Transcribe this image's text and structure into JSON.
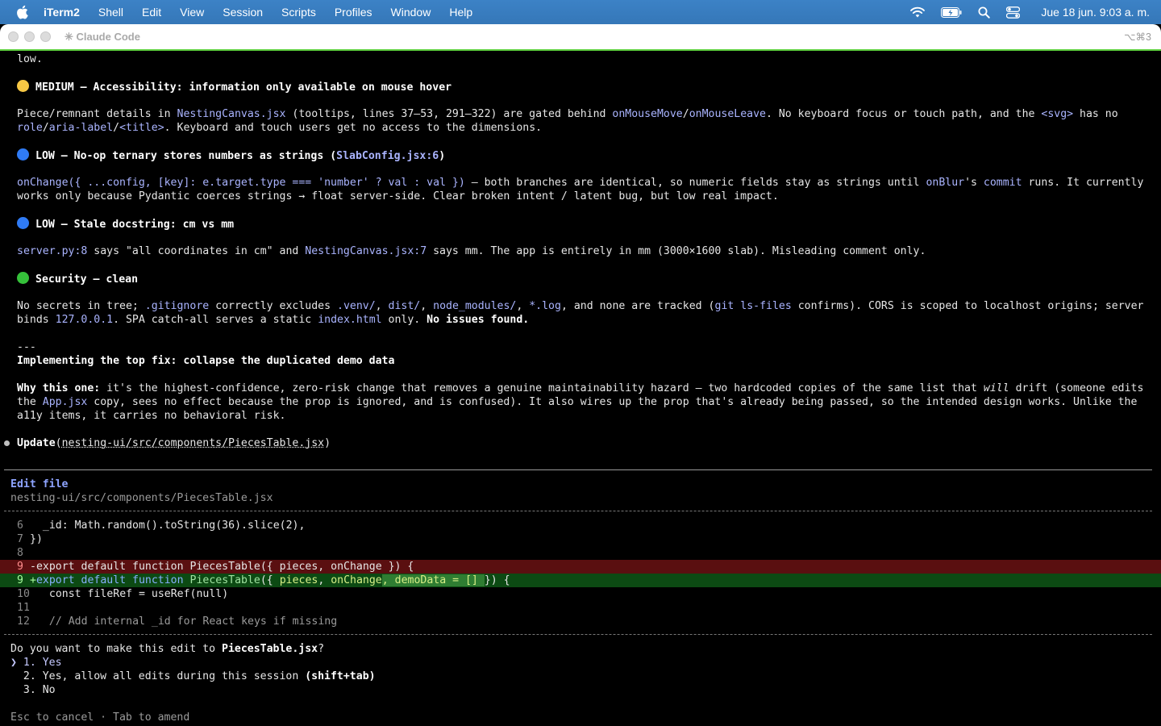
{
  "menubar": {
    "app": "iTerm2",
    "items": [
      "Shell",
      "Edit",
      "View",
      "Session",
      "Scripts",
      "Profiles",
      "Window",
      "Help"
    ],
    "clock": "Jue 18 jun.  9:03 a. m."
  },
  "window": {
    "title": "✳ Claude Code",
    "shortcut": "⌥⌘3"
  },
  "terminal": {
    "l0": "low.",
    "medium_head": "MEDIUM — Accessibility: information only available on mouse hover",
    "medium_p1_a": "Piece/remnant details in ",
    "medium_p1_code1": "NestingCanvas.jsx",
    "medium_p1_b": " (tooltips, lines 37–53, 291–322) are gated behind ",
    "medium_p1_code2": "onMouseMove",
    "medium_p1_slash": "/",
    "medium_p1_code3": "onMouseLeave",
    "medium_p1_c": ". No keyboard focus or touch path, and the ",
    "medium_p1_code4": "<svg>",
    "medium_p1_d": " has no",
    "medium_p2_code1": "role",
    "medium_p2_slash1": "/",
    "medium_p2_code2": "aria-label",
    "medium_p2_slash2": "/",
    "medium_p2_code3": "<title>",
    "medium_p2_a": ". Keyboard and touch users get no access to the dimensions.",
    "low1_head": "LOW — No-op ternary stores numbers as strings (",
    "low1_code": "SlabConfig.jsx:6",
    "low1_tail": ")",
    "low1_p1_code1": "onChange({ ...config, [key]: e.target.type === 'number' ? val : val })",
    "low1_p1_a": " — both branches are identical, so numeric fields stay as strings until ",
    "low1_p1_code2": "onBlur",
    "low1_p1_b": "'s ",
    "low1_p1_code3": "commit",
    "low1_p1_c": " runs. It currently",
    "low1_p2": "works only because Pydantic coerces strings → float server-side. Clear broken intent / latent bug, but low real impact.",
    "low2_head": "LOW — Stale docstring: cm vs mm",
    "low2_p1_code1": "server.py:8",
    "low2_p1_a": " says \"all coordinates in cm\" and ",
    "low2_p1_code2": "NestingCanvas.jsx:7",
    "low2_p1_b": " says mm. The app is entirely in mm (3000×1600 slab). Misleading comment only.",
    "sec_head": "Security — clean",
    "sec_p1_a": "No secrets in tree; ",
    "sec_p1_code1": ".gitignore",
    "sec_p1_b": " correctly excludes ",
    "sec_p1_code2": ".venv/",
    "sec_p1_c": ", ",
    "sec_p1_code3": "dist/",
    "sec_p1_d": ", ",
    "sec_p1_code4": "node_modules/",
    "sec_p1_e": ", ",
    "sec_p1_code5": "*.log",
    "sec_p1_f": ", and none are tracked (",
    "sec_p1_code6": "git ls-files",
    "sec_p1_g": " confirms). CORS is scoped to localhost origins; server",
    "sec_p2_a": "binds ",
    "sec_p2_code1": "127.0.0.1",
    "sec_p2_b": ". SPA catch-all serves a static ",
    "sec_p2_code2": "index.html",
    "sec_p2_c": " only. ",
    "sec_p2_bold": "No issues found.",
    "hr": "---",
    "impl_head": "Implementing the top fix: collapse the duplicated demo data",
    "why_bold": "Why this one:",
    "why_p1_a": " it's the highest-confidence, zero-risk change that removes a genuine maintainability hazard — two hardcoded copies of the same list that ",
    "why_p1_i": "will",
    "why_p1_b": " drift (someone edits",
    "why_p2_a": "the ",
    "why_p2_code": "App.jsx",
    "why_p2_b": " copy, sees no effect because the prop is ignored, and is confused). It also wires up the prop that's already being passed, so the intended design works. Unlike the",
    "why_p3": "a11y items, it carries no behavioral risk.",
    "update_bold": "Update",
    "update_path": "nesting-ui/src/components/PiecesTable.jsx",
    "edit_title": "Edit file",
    "edit_path": "nesting-ui/src/components/PiecesTable.jsx",
    "diff": {
      "r6_num": "6",
      "r6_txt": "  _id: Math.random().toString(36).slice(2),",
      "r7_num": "7",
      "r7_txt": "})",
      "r8_num": "8",
      "r9del_num": "9",
      "r9del_txt": "-export default function PiecesTable({ pieces, onChange }) {",
      "r9add_num": "9",
      "r9add_sign": "+",
      "r9add_kw1": "export default ",
      "r9add_kw2": "function ",
      "r9add_fn": "PiecesTable",
      "r9add_a": "({ ",
      "r9add_id1": "pieces",
      "r9add_b": ", ",
      "r9add_id2": "onChange",
      "r9add_hl": ", demoData = [] ",
      "r9add_c": "}) {",
      "r10_num": "10",
      "r10_txt": "  const fileRef = useRef(null)",
      "r11_num": "11",
      "r12_num": "12",
      "r12_txt": "  // Add internal _id for React keys if missing"
    },
    "question_a": "Do you want to make this edit to ",
    "question_file": "PiecesTable.jsx",
    "question_b": "?",
    "opt1": "❯ 1. Yes",
    "opt2_a": "  2. Yes, allow all edits during this session ",
    "opt2_b": "(shift+tab)",
    "opt3": "  3. No",
    "footer": "Esc to cancel · Tab to amend"
  },
  "colors": {
    "medium": "#f6c744",
    "low": "#2f7bf5",
    "security": "#35c13a"
  }
}
